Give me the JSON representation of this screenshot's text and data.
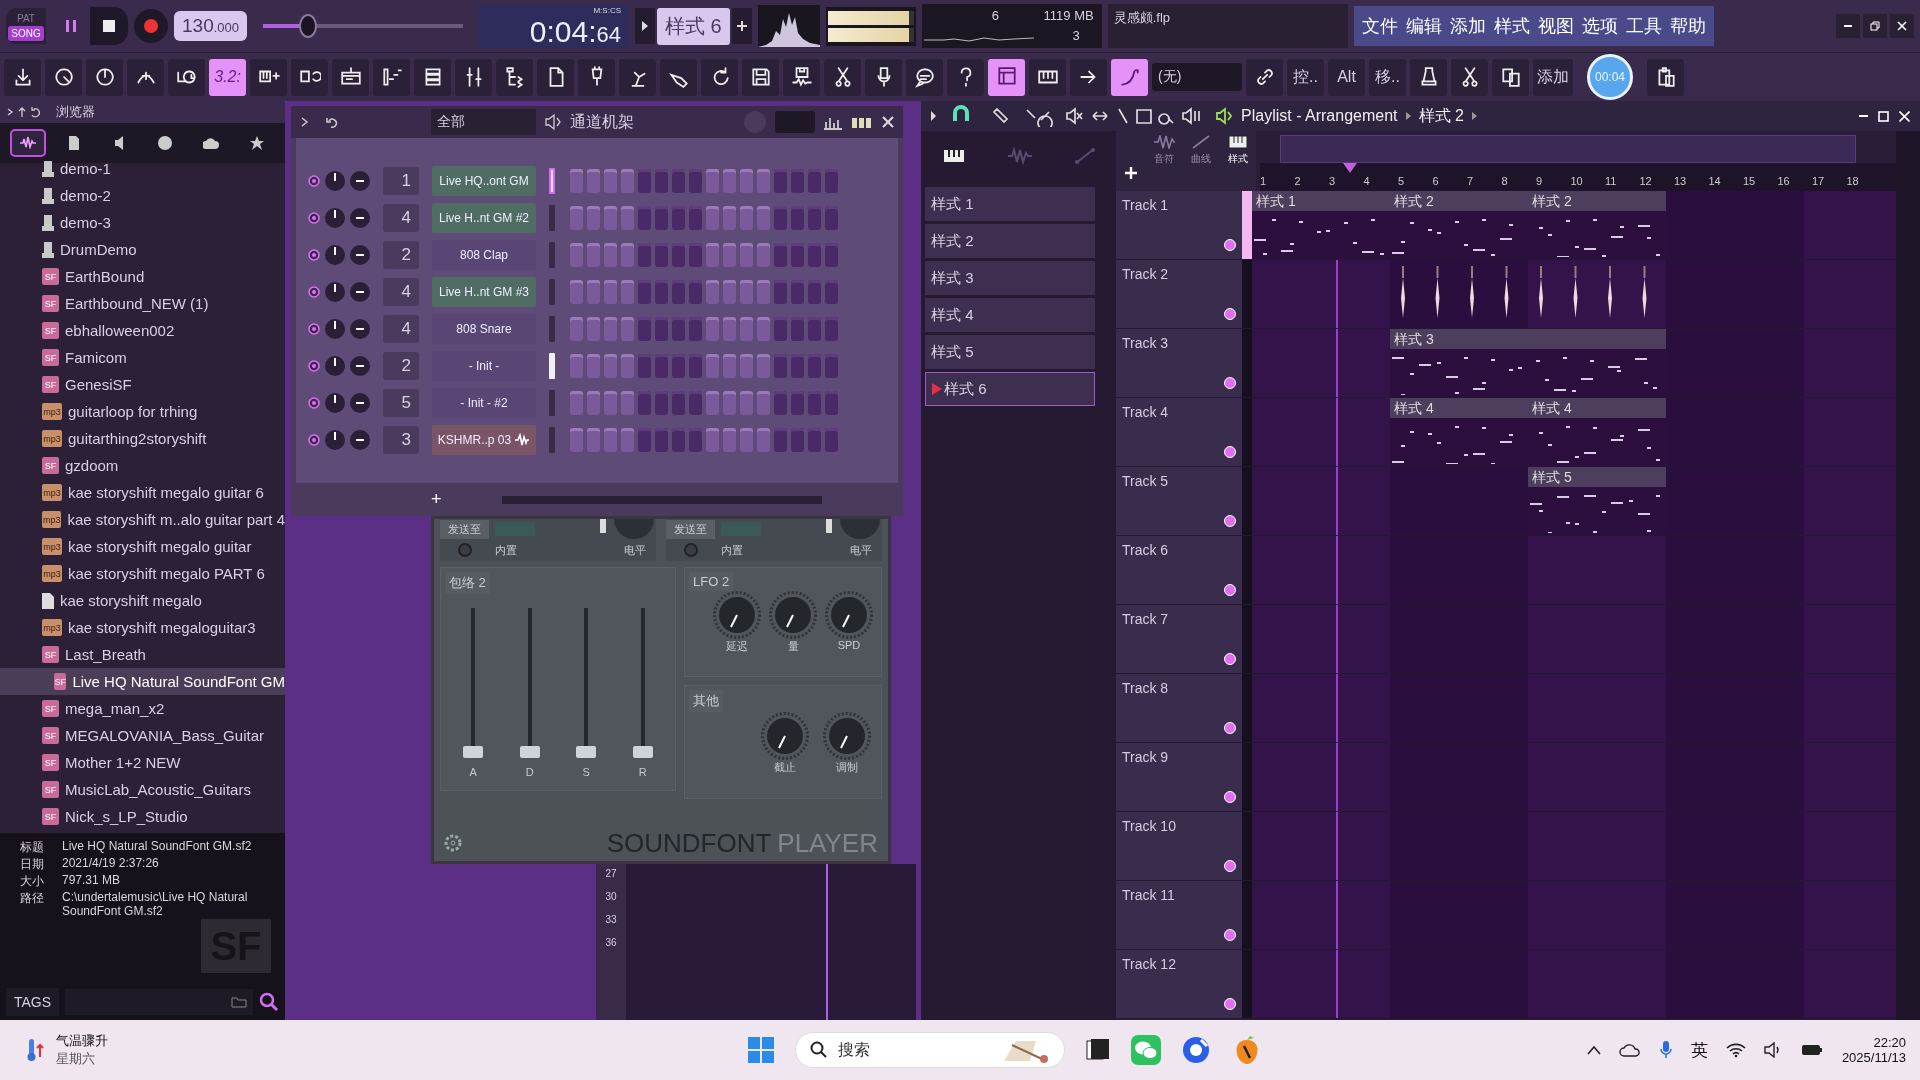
{
  "transport": {
    "pat": "PAT",
    "song": "SONG",
    "song_selected": true,
    "tempo": "130",
    "tempo_fraction": ".000",
    "master": {
      "level": 0.2
    },
    "time": "0:04:",
    "time_cs": "64",
    "time_format": "M:S:CS",
    "pattern": "样式 6"
  },
  "output_meters": [
    {
      "level": 0.95
    },
    {
      "level": 0.95
    }
  ],
  "monitor": {
    "cpu": "6",
    "memory": "1119 MB",
    "polyphony": "3"
  },
  "hint": "灵感颇.flp",
  "menu": [
    "文件",
    "编辑",
    "添加",
    "样式",
    "视图",
    "选项",
    "工具",
    "帮助"
  ],
  "toolbar": [
    {
      "kind": "icon",
      "on": false
    },
    {
      "kind": "icon",
      "on": false
    },
    {
      "kind": "icon",
      "on": false
    },
    {
      "kind": "icon",
      "on": false
    },
    {
      "kind": "icon",
      "on": false
    },
    {
      "kind": "text",
      "label": "3.2:",
      "on": true
    },
    {
      "kind": "icon",
      "on": false
    },
    {
      "kind": "icon",
      "on": false
    },
    {
      "kind": "icon",
      "on": false
    },
    {
      "kind": "icon",
      "on": false
    },
    {
      "kind": "icon",
      "on": false
    },
    {
      "kind": "icon",
      "on": false
    },
    {
      "kind": "icon",
      "on": false
    },
    {
      "kind": "icon",
      "on": false
    },
    {
      "kind": "icon",
      "on": false
    },
    {
      "kind": "icon",
      "on": false
    },
    {
      "kind": "icon",
      "on": false
    },
    {
      "kind": "icon",
      "on": false
    },
    {
      "kind": "icon",
      "on": false
    },
    {
      "kind": "icon",
      "on": false
    },
    {
      "kind": "icon",
      "on": false
    },
    {
      "kind": "icon",
      "on": false
    },
    {
      "kind": "icon",
      "on": false
    },
    {
      "kind": "icon",
      "on": false
    },
    {
      "kind": "icon",
      "on": true
    },
    {
      "kind": "icon",
      "on": false
    },
    {
      "kind": "icon",
      "on": false
    },
    {
      "kind": "icon",
      "on": true
    },
    {
      "kind": "snap",
      "label": "(无)"
    },
    {
      "kind": "icon",
      "on": false
    },
    {
      "kind": "text",
      "label": "控..",
      "on": false
    },
    {
      "kind": "text",
      "label": "Alt",
      "on": false
    },
    {
      "kind": "text",
      "label": "移..",
      "on": false
    },
    {
      "kind": "icon",
      "on": false
    },
    {
      "kind": "icon",
      "on": false
    },
    {
      "kind": "icon",
      "on": false
    },
    {
      "kind": "text",
      "label": "添加",
      "on": false
    },
    {
      "kind": "timer",
      "label": "00:04"
    },
    {
      "kind": "icon",
      "on": false
    }
  ],
  "browser": {
    "title": "浏览器",
    "tabs": [
      {
        "selected": true
      },
      {
        "selected": false
      },
      {
        "selected": false
      },
      {
        "selected": false
      },
      {
        "selected": false
      },
      {
        "selected": false
      }
    ],
    "items": [
      {
        "kind": "plugin",
        "label": "demo-1",
        "selected": false
      },
      {
        "kind": "plugin",
        "label": "demo-2",
        "selected": false
      },
      {
        "kind": "plugin",
        "label": "demo-3",
        "selected": false
      },
      {
        "kind": "plugin",
        "label": "DrumDemo",
        "selected": false
      },
      {
        "kind": "badge",
        "badge": "SF",
        "label": "EarthBound",
        "selected": false
      },
      {
        "kind": "badge",
        "badge": "SF",
        "label": "Earthbound_NEW (1)",
        "selected": false
      },
      {
        "kind": "badge",
        "badge": "SF",
        "label": "ebhalloween002",
        "selected": false
      },
      {
        "kind": "badge",
        "badge": "SF",
        "label": "Famicom",
        "selected": false
      },
      {
        "kind": "badge",
        "badge": "SF",
        "label": "GenesiSF",
        "selected": false
      },
      {
        "kind": "audio",
        "badge": "mp3",
        "label": "guitarloop for trhing",
        "selected": false
      },
      {
        "kind": "audio",
        "badge": "mp3",
        "label": "guitarthing2storyshift",
        "selected": false
      },
      {
        "kind": "badge",
        "badge": "SF",
        "label": "gzdoom",
        "selected": false
      },
      {
        "kind": "audio",
        "badge": "mp3",
        "label": "kae storyshift megalo guitar 6",
        "selected": false
      },
      {
        "kind": "audio",
        "badge": "mp3",
        "label": "kae storyshift m..alo guitar part 4",
        "selected": false
      },
      {
        "kind": "audio",
        "badge": "mp3",
        "label": "kae storyshift megalo guitar",
        "selected": false
      },
      {
        "kind": "audio",
        "badge": "mp3",
        "label": "kae storyshift megalo PART 6",
        "selected": false
      },
      {
        "kind": "file",
        "label": "kae storyshift megalo",
        "selected": false
      },
      {
        "kind": "audio",
        "badge": "mp3",
        "label": "kae storyshift megaloguitar3",
        "selected": false
      },
      {
        "kind": "badge",
        "badge": "SF",
        "label": "Last_Breath",
        "selected": false
      },
      {
        "kind": "badge",
        "badge": "SF",
        "label": "Live HQ Natural SoundFont GM",
        "selected": true
      },
      {
        "kind": "badge",
        "badge": "SF",
        "label": "mega_man_x2",
        "selected": false
      },
      {
        "kind": "badge",
        "badge": "SF",
        "label": "MEGALOVANIA_Bass_Guitar",
        "selected": false
      },
      {
        "kind": "badge",
        "badge": "SF",
        "label": "Mother 1+2 NEW",
        "selected": false
      },
      {
        "kind": "badge",
        "badge": "SF",
        "label": "MusicLab_Acoustic_Guitars",
        "selected": false
      },
      {
        "kind": "badge",
        "badge": "SF",
        "label": "Nick_s_LP_Studio",
        "selected": false
      }
    ],
    "info": [
      {
        "label": "标题",
        "value": "Live HQ Natural SoundFont GM.sf2"
      },
      {
        "label": "日期",
        "value": "2021/4/19 2:37:26"
      },
      {
        "label": "大小",
        "value": "797.31 MB"
      },
      {
        "label": "路径",
        "value": "C:\\undertalemusic\\Live HQ Natural SoundFont GM.sf2"
      }
    ],
    "preview_badge": "SF",
    "tags": "TAGS"
  },
  "channel_rack": {
    "filter": "全部",
    "title": "通道机架",
    "channels": [
      {
        "number": "1",
        "name": "Live HQ..ont GM",
        "kind": "soundfont",
        "selected": true,
        "lit": false
      },
      {
        "number": "4",
        "name": "Live H..nt GM #2",
        "kind": "soundfont",
        "selected": false,
        "lit": false
      },
      {
        "number": "2",
        "name": "808 Clap",
        "kind": "sampler",
        "selected": false,
        "lit": false
      },
      {
        "number": "4",
        "name": "Live H..nt GM #3",
        "kind": "soundfont",
        "selected": false,
        "lit": false
      },
      {
        "number": "4",
        "name": "808 Snare",
        "kind": "sampler",
        "selected": false,
        "lit": false
      },
      {
        "number": "2",
        "name": "- Init -",
        "kind": "sampler",
        "selected": false,
        "lit": true
      },
      {
        "number": "5",
        "name": "- Init -  #2",
        "kind": "sampler",
        "selected": false,
        "lit": false
      },
      {
        "number": "3",
        "name": "KSHMR..p 03",
        "kind": "audio",
        "selected": false,
        "lit": false
      }
    ],
    "add": "+"
  },
  "soundfont_player": {
    "sends": [
      {
        "label": "发送至",
        "builtin": "内置",
        "builtin_on": false,
        "level_label": "电平"
      },
      {
        "label": "发送至",
        "builtin": "内置",
        "builtin_on": false,
        "level_label": "电平"
      }
    ],
    "envelope": {
      "title": "包络 2",
      "sliders": [
        {
          "label": "A",
          "level": 0
        },
        {
          "label": "D",
          "level": 0
        },
        {
          "label": "S",
          "level": 0
        },
        {
          "label": "R",
          "level": 0
        }
      ]
    },
    "lfo": {
      "title": "LFO 2",
      "knobs": [
        "延迟",
        "量",
        "SPD"
      ]
    },
    "other": {
      "title": "其他",
      "knobs": [
        "截止",
        "调制"
      ]
    },
    "brand": "SOUNDFONT",
    "brand_2": "PLAYER"
  },
  "piano_roll_keys": [
    "27",
    "30",
    "33",
    "36"
  ],
  "playlist": {
    "title": "Playlist - Arrangement",
    "pattern": "样式 2",
    "tool_tabs": [
      "音符",
      "曲线",
      "样式"
    ],
    "patterns": [
      {
        "label": "样式 1",
        "selected": false
      },
      {
        "label": "样式 2",
        "selected": false
      },
      {
        "label": "样式 3",
        "selected": false
      },
      {
        "label": "样式 4",
        "selected": false
      },
      {
        "label": "样式 5",
        "selected": false
      },
      {
        "label": "样式 6",
        "selected": true
      }
    ],
    "ruler": [
      "1",
      "2",
      "3",
      "4",
      "5",
      "6",
      "7",
      "8",
      "9",
      "10",
      "11",
      "12",
      "13",
      "14",
      "15",
      "16",
      "17",
      "18"
    ],
    "playhead": {
      "level": 0.13
    },
    "tracks": [
      {
        "name": "Track 1",
        "cells": [
          {
            "kind": "pattern",
            "label": "样式 1",
            "joined": false
          },
          {
            "kind": "pattern",
            "label": "样式 2",
            "joined": false
          },
          {
            "kind": "pattern",
            "label": "样式 2",
            "joined": false
          }
        ]
      },
      {
        "name": "Track 2",
        "cells": [
          {
            "kind": "empty"
          },
          {
            "kind": "audio",
            "joined": true
          }
        ]
      },
      {
        "name": "Track 3",
        "cells": [
          {
            "kind": "empty"
          },
          {
            "kind": "pattern",
            "label": "样式 3",
            "joined": true
          }
        ]
      },
      {
        "name": "Track 4",
        "cells": [
          {
            "kind": "empty"
          },
          {
            "kind": "pattern",
            "label": "样式 4",
            "joined": false
          },
          {
            "kind": "pattern",
            "label": "样式 4",
            "joined": false
          }
        ]
      },
      {
        "name": "Track 5",
        "cells": [
          {
            "kind": "empty"
          },
          {
            "kind": "empty"
          },
          {
            "kind": "pattern",
            "label": "样式 5",
            "joined": false
          }
        ]
      },
      {
        "name": "Track 6"
      },
      {
        "name": "Track 7"
      },
      {
        "name": "Track 8"
      },
      {
        "name": "Track 9"
      },
      {
        "name": "Track 10"
      },
      {
        "name": "Track 11"
      },
      {
        "name": "Track 12"
      }
    ]
  },
  "taskbar": {
    "weather": "气温骤升",
    "weekday": "星期六",
    "search": "搜索",
    "ime": "英",
    "time": "22:20",
    "date": "2025/11/13"
  }
}
